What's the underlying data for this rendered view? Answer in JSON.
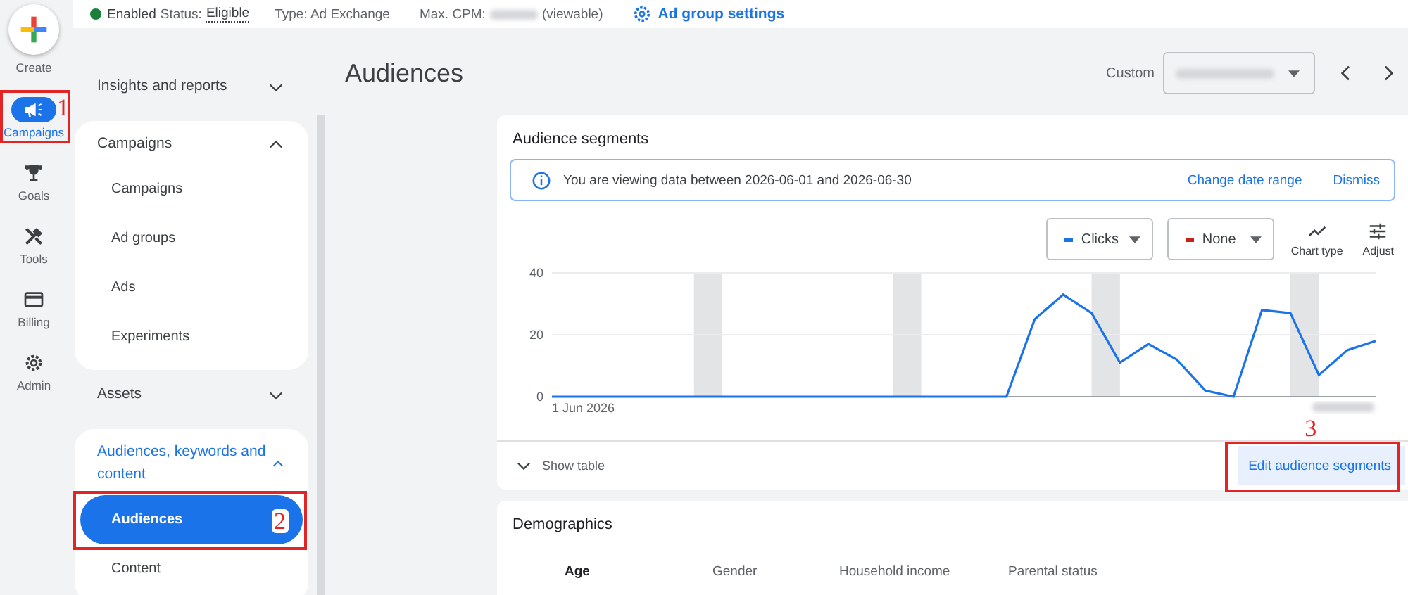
{
  "rail": {
    "create": "Create",
    "items": [
      {
        "label": "Campaigns",
        "selected": true,
        "callout": "1"
      },
      {
        "label": "Goals",
        "selected": false
      },
      {
        "label": "Tools",
        "selected": false
      },
      {
        "label": "Billing",
        "selected": false
      },
      {
        "label": "Admin",
        "selected": false
      }
    ]
  },
  "top_bar": {
    "status": "Enabled",
    "status_enabled": true,
    "status_label": "Status:",
    "status_value": "Eligible",
    "type": "Type: Ad Exchange",
    "max_cpm_label": "Max. CPM:",
    "max_cpm_suffix": "(viewable)",
    "settings_link": "Ad group settings"
  },
  "nav": {
    "sections": [
      {
        "label": "Insights and reports",
        "expanded": false
      },
      {
        "label": "Campaigns",
        "expanded": true,
        "children": [
          {
            "label": "Campaigns",
            "selected": false
          },
          {
            "label": "Ad groups",
            "selected": false
          },
          {
            "label": "Ads",
            "selected": false
          },
          {
            "label": "Experiments",
            "selected": false
          }
        ]
      },
      {
        "label": "Assets",
        "expanded": false
      },
      {
        "label": "Audiences, keywords and content",
        "expanded": true,
        "children": [
          {
            "label": "Audiences",
            "selected": true,
            "callout": "2"
          },
          {
            "label": "Content",
            "selected": false
          }
        ]
      }
    ]
  },
  "page": {
    "title": "Audiences",
    "date_label": "Custom"
  },
  "segments_card": {
    "title": "Audience segments",
    "banner": {
      "text": "You are viewing data between 2026-06-01 and 2026-06-30",
      "action": "Change date range",
      "dismiss": "Dismiss"
    },
    "metrics": [
      {
        "label": "Clicks",
        "color": "#1a73e8"
      },
      {
        "label": "None",
        "color": "#c5221f"
      }
    ],
    "tools": [
      {
        "label": "Chart type"
      },
      {
        "label": "Adjust"
      }
    ],
    "chart_data": {
      "type": "line",
      "series": [
        {
          "color": "#1a73e8",
          "values": [
            0,
            0,
            0,
            0,
            0,
            0,
            0,
            0,
            0,
            0,
            0,
            0,
            0,
            0,
            0,
            0,
            0,
            25,
            33,
            27,
            11,
            17,
            12,
            2,
            0,
            28,
            27,
            7,
            15,
            18
          ]
        }
      ],
      "ylim": [
        0,
        40
      ],
      "yticks": [
        {
          "value": 0,
          "label": "0"
        },
        {
          "value": 20,
          "label": "20"
        },
        {
          "value": 40,
          "label": "40"
        }
      ],
      "annotations": [
        "1 Jun 2026"
      ]
    },
    "show_table": "Show table",
    "edit_button": {
      "label": "Edit audience segments",
      "callout": "3"
    }
  },
  "demographics_card": {
    "title": "Demographics",
    "tabs": [
      {
        "label": "Age",
        "selected": true
      },
      {
        "label": "Gender",
        "selected": false
      },
      {
        "label": "Household income",
        "selected": false
      },
      {
        "label": "Parental status",
        "selected": false
      }
    ]
  }
}
